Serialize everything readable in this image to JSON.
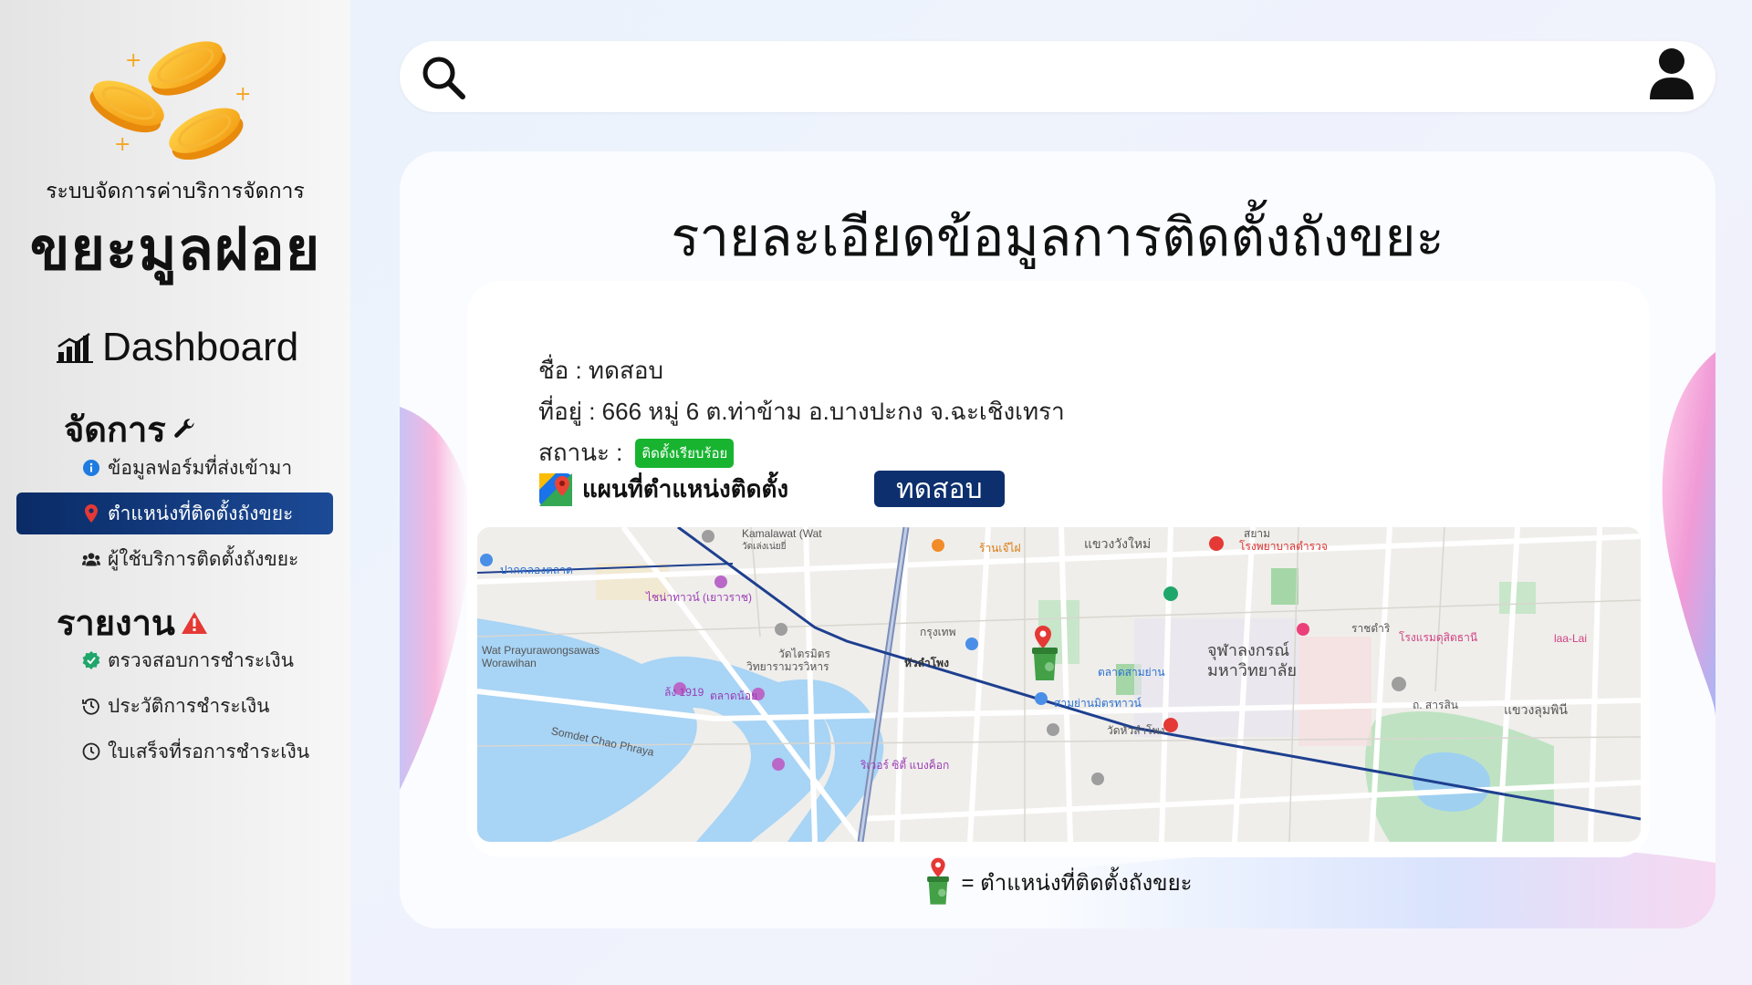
{
  "brand": {
    "subtitle": "ระบบจัดการค่าบริการจัดการ",
    "title": "ขยะมูลฝอย"
  },
  "sidebar": {
    "dashboard_label": "Dashboard",
    "manage_section": "จัดการ",
    "manage_items": [
      {
        "label": "ข้อมูลฟอร์มที่ส่งเข้ามา",
        "icon": "info-icon",
        "active": false
      },
      {
        "label": "ตำแหน่งที่ติดตั้งถังขยะ",
        "icon": "location-pin-icon",
        "active": true
      },
      {
        "label": "ผู้ใช้บริการติดตั้งถังขยะ",
        "icon": "users-icon",
        "active": false
      }
    ],
    "report_section": "รายงาน",
    "report_items": [
      {
        "label": "ตรวจสอบการชำระเงิน",
        "icon": "verified-badge-icon"
      },
      {
        "label": "ประวัติการชำระเงิน",
        "icon": "history-icon"
      },
      {
        "label": "ใบเสร็จที่รอการชำระเงิน",
        "icon": "clock-icon"
      }
    ],
    "active_color": "#0d2f6d"
  },
  "page": {
    "title": "รายละเอียดข้อมูลการติดตั้งถังขยะ",
    "name_line": "ชื่อ : ทดสอบ",
    "address_line": "ที่อยู่ : 666 หมู่ 6 ต.ท่าข้าม อ.บางปะกง จ.ฉะเชิงเทรา",
    "status_label": "สถานะ :",
    "status_badge": "ติดตั้งเรียบร้อย",
    "status_color": "#18b430",
    "map_heading": "แผนที่ตำแหน่งติดตั้ง",
    "pin_label": "ทดสอบ",
    "legend_text": "= ตำแหน่งที่ติดตั้งถังขยะ"
  },
  "map": {
    "labels": [
      {
        "id": "kamalawat",
        "text": "Kamalawat (Wat"
      },
      {
        "id": "kamalawat-th",
        "text": "วัดเล่งเน่ยยี่"
      },
      {
        "id": "chinatown",
        "text": "ไชน่าทาวน์ (เยาวราช)"
      },
      {
        "id": "wat-prayurawong",
        "text": "Wat Prayurawongsawas"
      },
      {
        "id": "worawihan",
        "text": "Worawihan"
      },
      {
        "id": "pak-khlong",
        "text": "ปากคลองตลาด"
      },
      {
        "id": "wat-traimit",
        "text": "วัดไตรมิตร"
      },
      {
        "id": "wat-traimit-2",
        "text": "วิทยารามวรวิหาร"
      },
      {
        "id": "hua-lamphong",
        "text": "หัวลำโพง"
      },
      {
        "id": "chula",
        "text": "จุฬาลงกรณ์"
      },
      {
        "id": "chula-2",
        "text": "มหาวิทยาลัย"
      },
      {
        "id": "talad-samyan",
        "text": "ตลาดสามย่าน"
      },
      {
        "id": "samyan-mitrtown",
        "text": "สามย่านมิตรทาวน์"
      },
      {
        "id": "wat-hualamphong",
        "text": "วัดหัวลำโพง"
      },
      {
        "id": "lhong-1919",
        "text": "ล้ง 1919"
      },
      {
        "id": "talad-noi",
        "text": "ตลาดน้อย"
      },
      {
        "id": "somdet-chao",
        "text": "Somdet Chao Phraya"
      },
      {
        "id": "river-city",
        "text": "ริเวอร์ ซิตี้ แบงค็อก"
      },
      {
        "id": "khwaeng-wang-mai",
        "text": "แขวงวังใหม่"
      },
      {
        "id": "khwaeng-lumphini",
        "text": "แขวงลุมพินี"
      },
      {
        "id": "police-hospital",
        "text": "โรงพยาบาลตำรวจ"
      },
      {
        "id": "rajdamri",
        "text": "ราชดำริ"
      },
      {
        "id": "dusit-hotel",
        "text": "โรงแรมดุสิตธานี"
      },
      {
        "id": "laa-lai",
        "text": "laa-Lai"
      },
      {
        "id": "ran-jay-fai",
        "text": "ร้านเจ๊ไฝ"
      },
      {
        "id": "bangkok",
        "text": "กรุงเทพ"
      },
      {
        "id": "sarasin",
        "text": "ถ. สารสิน"
      },
      {
        "id": "siam",
        "text": "สยาม"
      }
    ]
  }
}
